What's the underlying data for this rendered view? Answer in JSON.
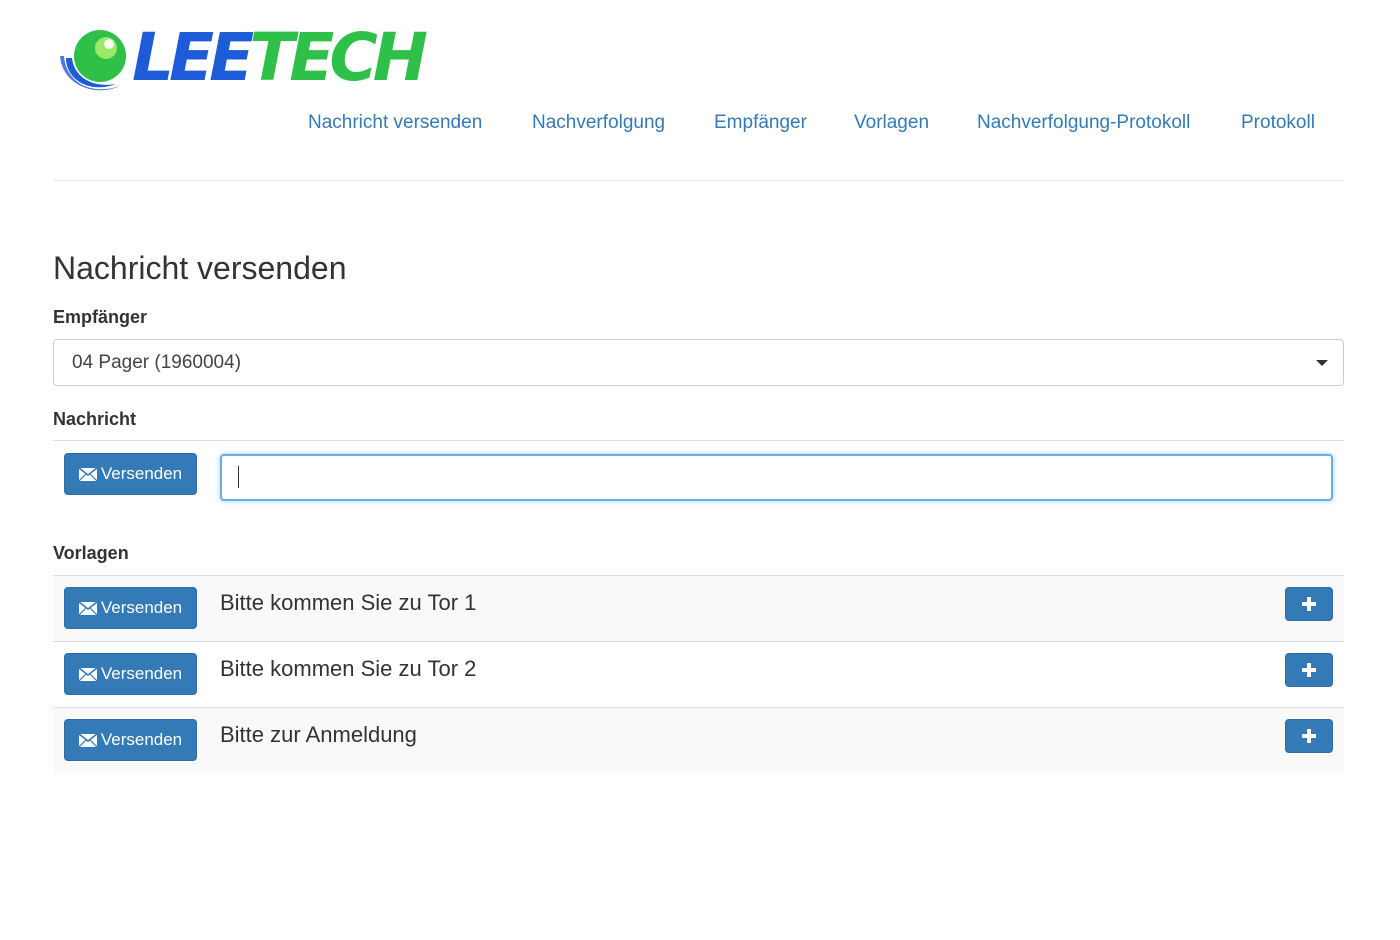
{
  "brand": {
    "name_part1": "LEE",
    "name_part2": "TECH",
    "color_primary": "#1e5bd6",
    "color_secondary": "#2fc04a",
    "icon": "globe-swoosh-logo"
  },
  "nav": {
    "items": [
      {
        "label": "Nachricht versenden"
      },
      {
        "label": "Nachverfolgung"
      },
      {
        "label": "Empfänger"
      },
      {
        "label": "Vorlagen"
      },
      {
        "label": "Nachverfolgung-Protokoll"
      },
      {
        "label": "Protokoll"
      }
    ],
    "link_color": "#337ab7"
  },
  "page": {
    "title": "Nachricht versenden"
  },
  "recipient": {
    "label": "Empfänger",
    "selected": "04 Pager (1960004)",
    "icon": "caret-down-icon"
  },
  "message": {
    "label": "Nachricht",
    "send_label": "Versenden",
    "send_icon": "envelope-icon",
    "value": ""
  },
  "templates": {
    "label": "Vorlagen",
    "send_label": "Versenden",
    "add_icon": "plus-icon",
    "items": [
      {
        "text": "Bitte kommen Sie zu Tor 1"
      },
      {
        "text": "Bitte kommen Sie zu Tor 2"
      },
      {
        "text": "Bitte zur Anmeldung"
      }
    ]
  },
  "colors": {
    "button_primary": "#337ab7",
    "input_focus_border": "#66afe9"
  }
}
